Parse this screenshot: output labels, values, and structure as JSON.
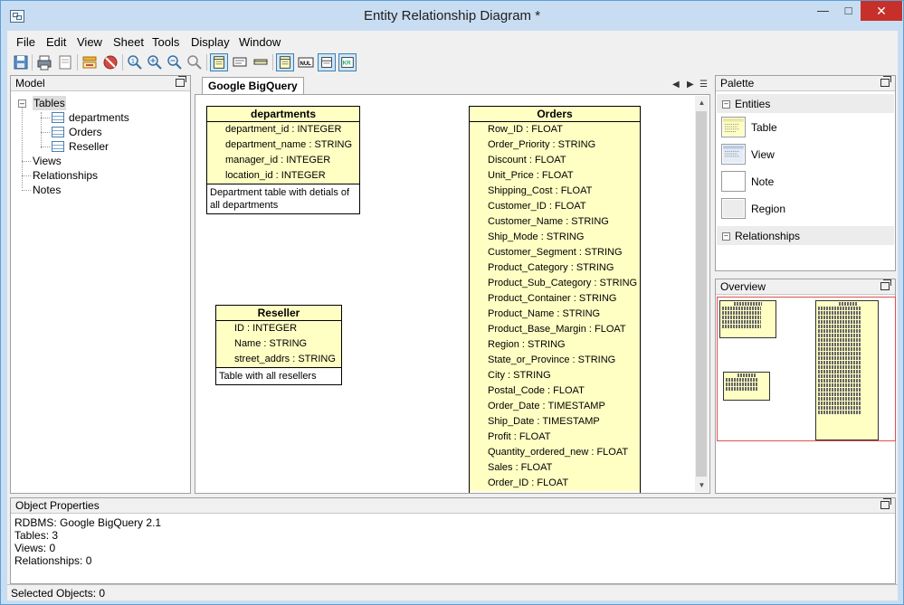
{
  "window": {
    "title": "Entity Relationship Diagram *"
  },
  "menu": [
    "File",
    "Edit",
    "View",
    "Sheet",
    "Tools",
    "Display",
    "Window"
  ],
  "toolbar": {
    "buttons": [
      "save-icon",
      "print-icon",
      "page-setup-icon",
      "properties-icon",
      "stop-icon",
      "zoom-actual-icon",
      "zoom-in-icon",
      "zoom-out-icon",
      "zoom-fit-icon",
      "table-view-icon",
      "compact-view-icon",
      "header-view-icon",
      "grid-view-icon",
      "null-icon",
      "detail-view-icon",
      "key-icon"
    ]
  },
  "model": {
    "title": "Model",
    "tree": {
      "tables_label": "Tables",
      "tables": [
        "departments",
        "Orders",
        "Reseller"
      ],
      "views_label": "Views",
      "relationships_label": "Relationships",
      "notes_label": "Notes"
    }
  },
  "canvas": {
    "tab": "Google BigQuery",
    "entities": [
      {
        "name": "departments",
        "columns": [
          "department_id : INTEGER",
          "department_name : STRING",
          "manager_id : INTEGER",
          "location_id : INTEGER"
        ],
        "description": "Department table with detials of all departments"
      },
      {
        "name": "Reseller",
        "columns": [
          "ID : INTEGER",
          "Name : STRING",
          "street_addrs : STRING"
        ],
        "description": "Table with all resellers"
      },
      {
        "name": "Orders",
        "columns": [
          "Row_ID : FLOAT",
          "Order_Priority : STRING",
          "Discount : FLOAT",
          "Unit_Price : FLOAT",
          "Shipping_Cost : FLOAT",
          "Customer_ID : FLOAT",
          "Customer_Name : STRING",
          "Ship_Mode : STRING",
          "Customer_Segment : STRING",
          "Product_Category : STRING",
          "Product_Sub_Category : STRING",
          "Product_Container : STRING",
          "Product_Name : STRING",
          "Product_Base_Margin : FLOAT",
          "Region : STRING",
          "State_or_Province : STRING",
          "City : STRING",
          "Postal_Code : FLOAT",
          "Order_Date : TIMESTAMP",
          "Ship_Date : TIMESTAMP",
          "Profit : FLOAT",
          "Quantity_ordered_new : FLOAT",
          "Sales : FLOAT",
          "Order_ID : FLOAT"
        ]
      }
    ]
  },
  "palette": {
    "title": "Palette",
    "entities_label": "Entities",
    "items": [
      "Table",
      "View",
      "Note",
      "Region"
    ],
    "relationships_label": "Relationships"
  },
  "overview": {
    "title": "Overview"
  },
  "object_properties": {
    "title": "Object Properties",
    "lines": [
      "RDBMS: Google BigQuery 2.1",
      "Tables: 3",
      "Views: 0",
      "Relationships: 0"
    ]
  },
  "status": {
    "selected": "Selected Objects: 0"
  }
}
